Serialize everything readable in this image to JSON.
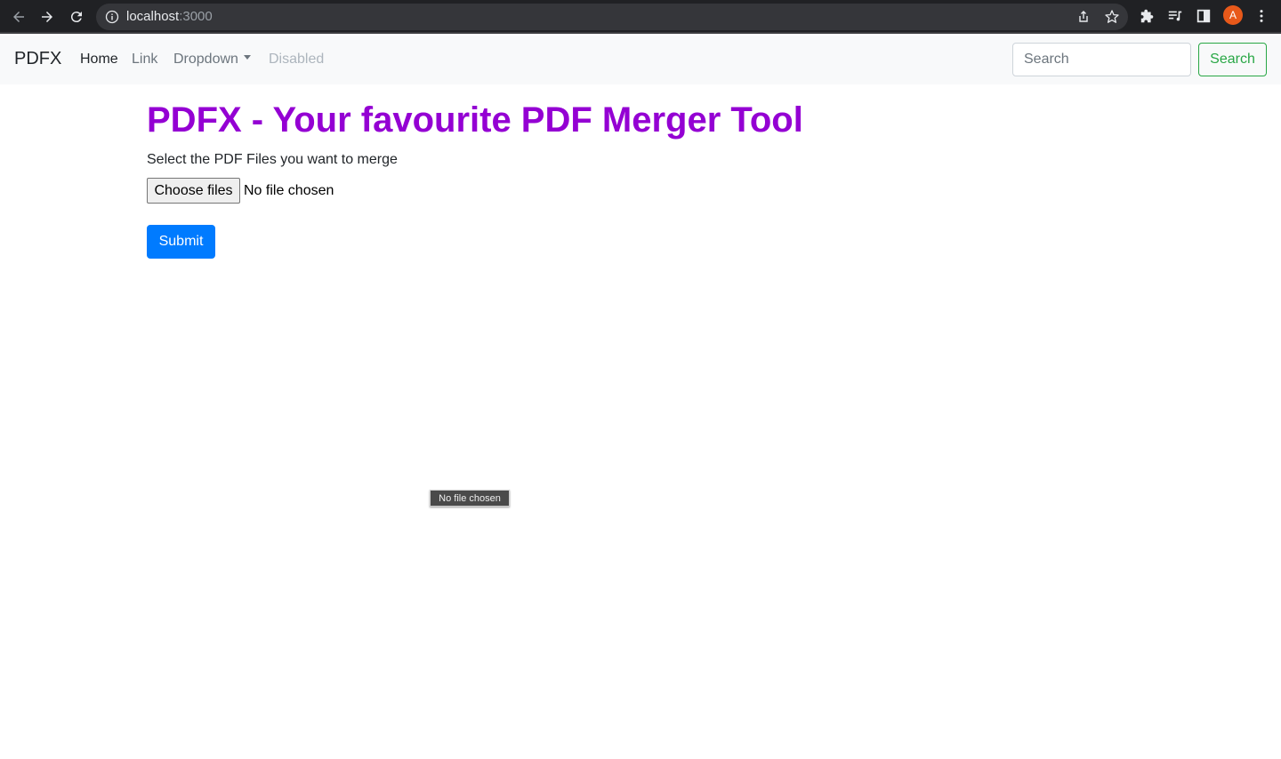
{
  "browser": {
    "url_host": "localhost",
    "url_port": ":3000",
    "avatar_letter": "A",
    "icons": [
      "back-icon",
      "forward-icon",
      "reload-icon",
      "info-icon",
      "share-icon",
      "star-icon",
      "extensions-icon",
      "media-icon",
      "sidepanel-icon",
      "menu-icon"
    ]
  },
  "navbar": {
    "brand": "PDFX",
    "links": [
      {
        "label": "Home",
        "state": "active"
      },
      {
        "label": "Link",
        "state": "normal"
      },
      {
        "label": "Dropdown",
        "state": "normal"
      },
      {
        "label": "Disabled",
        "state": "disabled"
      }
    ],
    "search_placeholder": "Search",
    "search_button": "Search"
  },
  "main": {
    "title": "PDFX - Your favourite PDF Merger Tool",
    "prompt": "Select the PDF Files you want to merge",
    "choose_button": "Choose files",
    "file_status": "No file chosen",
    "submit_button": "Submit",
    "tooltip": "No file chosen"
  },
  "colors": {
    "title": "#9400d3",
    "primary": "#007bff",
    "success": "#28a745",
    "navbar_bg": "#f8f9fa"
  }
}
